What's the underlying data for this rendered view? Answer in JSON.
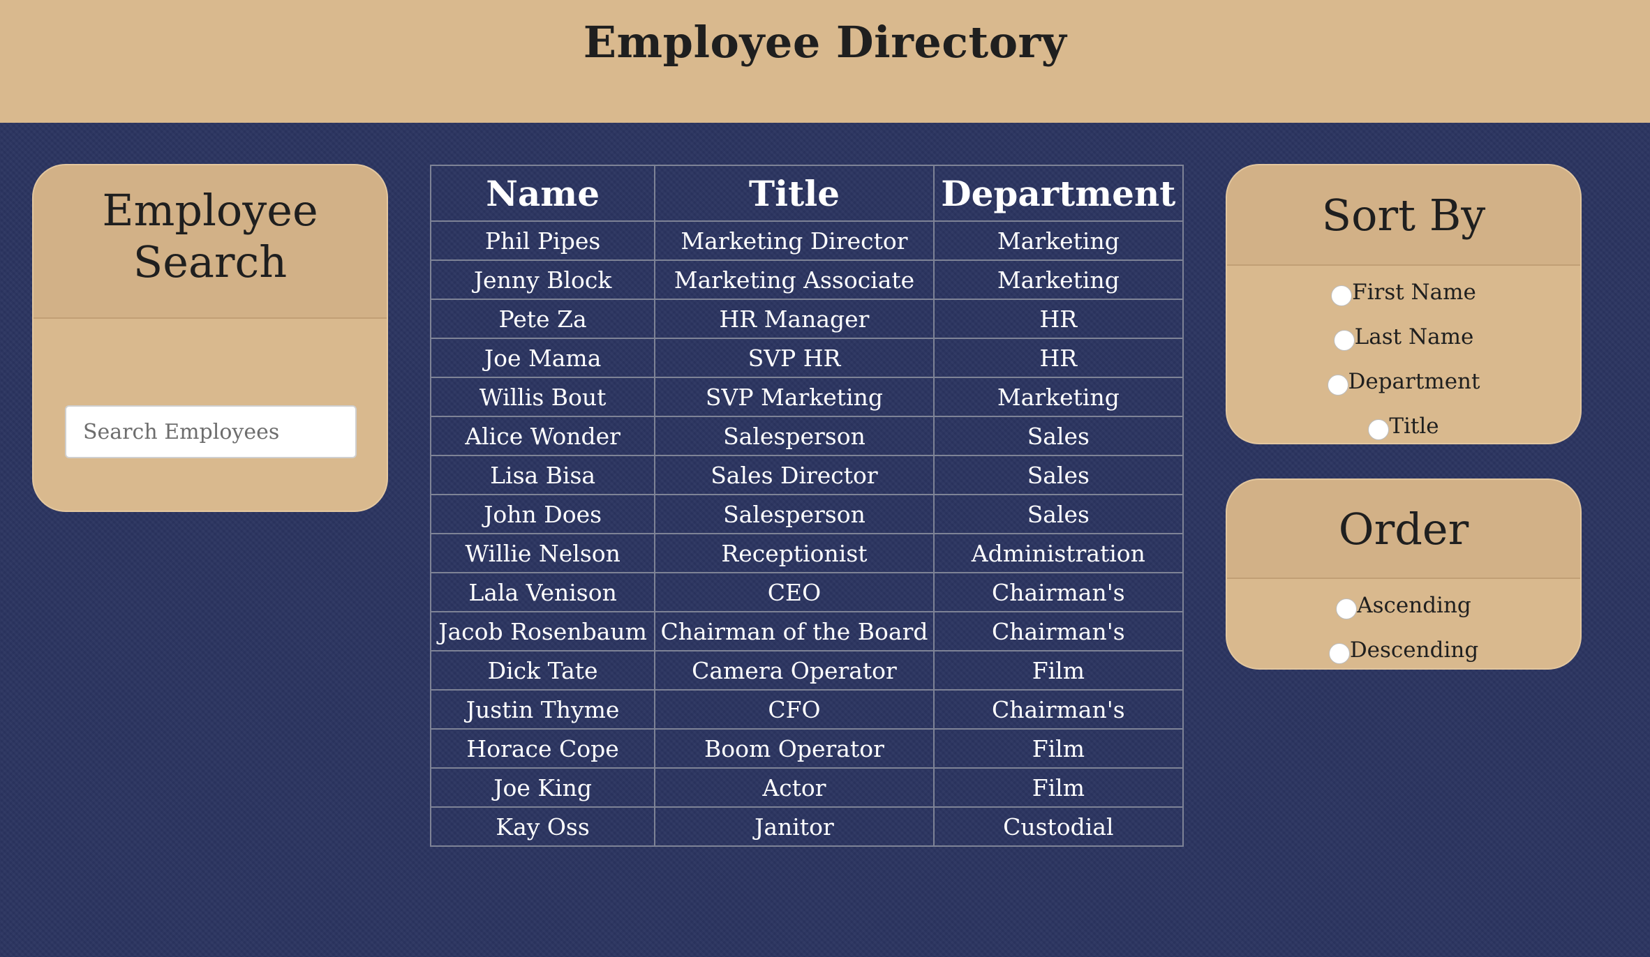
{
  "header": {
    "title": "Employee Directory"
  },
  "search": {
    "heading_line1": "Employee",
    "heading_line2": "Search",
    "placeholder": "Search Employees"
  },
  "table": {
    "columns": [
      "Name",
      "Title",
      "Department"
    ],
    "rows": [
      [
        "Phil Pipes",
        "Marketing Director",
        "Marketing"
      ],
      [
        "Jenny Block",
        "Marketing Associate",
        "Marketing"
      ],
      [
        "Pete Za",
        "HR Manager",
        "HR"
      ],
      [
        "Joe Mama",
        "SVP HR",
        "HR"
      ],
      [
        "Willis Bout",
        "SVP Marketing",
        "Marketing"
      ],
      [
        "Alice Wonder",
        "Salesperson",
        "Sales"
      ],
      [
        "Lisa Bisa",
        "Sales Director",
        "Sales"
      ],
      [
        "John Does",
        "Salesperson",
        "Sales"
      ],
      [
        "Willie Nelson",
        "Receptionist",
        "Administration"
      ],
      [
        "Lala Venison",
        "CEO",
        "Chairman's"
      ],
      [
        "Jacob Rosenbaum",
        "Chairman of the Board",
        "Chairman's"
      ],
      [
        "Dick Tate",
        "Camera Operator",
        "Film"
      ],
      [
        "Justin Thyme",
        "CFO",
        "Chairman's"
      ],
      [
        "Horace Cope",
        "Boom Operator",
        "Film"
      ],
      [
        "Joe King",
        "Actor",
        "Film"
      ],
      [
        "Kay Oss",
        "Janitor",
        "Custodial"
      ]
    ]
  },
  "sort": {
    "heading": "Sort By",
    "options": [
      "First Name",
      "Last Name",
      "Department",
      "Title"
    ]
  },
  "order": {
    "heading": "Order",
    "options": [
      "Ascending",
      "Descending"
    ]
  },
  "colors": {
    "background": "#2b3460",
    "panel": "#d9b98e",
    "panel_header": "#d2b187",
    "table_text": "#ffffff"
  }
}
